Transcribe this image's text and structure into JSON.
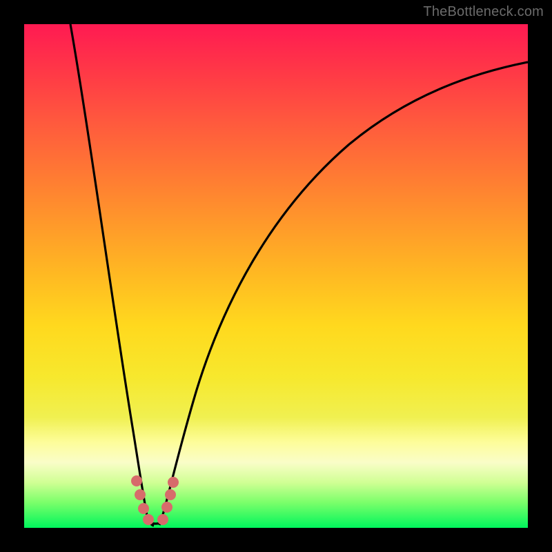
{
  "watermark": "TheBottleneck.com",
  "colors": {
    "frame": "#000000",
    "gradient_top": "#ff1a52",
    "gradient_bottom": "#00f55c",
    "curve": "#000000",
    "marker": "#d76b6b"
  },
  "chart_data": {
    "type": "line",
    "title": "",
    "xlabel": "",
    "ylabel": "",
    "xlim": [
      0,
      100
    ],
    "ylim": [
      0,
      100
    ],
    "grid": false,
    "legend": false,
    "note": "Axes are unlabeled; values estimated from pixel positions on a 0–100 scale.",
    "series": [
      {
        "name": "left-branch",
        "x": [
          9,
          11,
          13,
          15,
          17,
          18.5,
          20,
          21,
          22,
          24
        ],
        "y": [
          100,
          82,
          65,
          48,
          32,
          22,
          14,
          9,
          5,
          1
        ]
      },
      {
        "name": "valley",
        "x": [
          24,
          25,
          26,
          27,
          28
        ],
        "y": [
          1,
          0.5,
          0.5,
          0.6,
          1
        ]
      },
      {
        "name": "right-branch",
        "x": [
          28,
          30,
          33,
          37,
          42,
          48,
          55,
          63,
          72,
          82,
          92,
          100
        ],
        "y": [
          1,
          8,
          20,
          34,
          47,
          58,
          67,
          75,
          81,
          86,
          89.5,
          92
        ]
      }
    ],
    "markers": [
      {
        "x": 21.5,
        "y": 8
      },
      {
        "x": 22.2,
        "y": 5
      },
      {
        "x": 23.0,
        "y": 3
      },
      {
        "x": 24.2,
        "y": 1.2
      },
      {
        "x": 27.8,
        "y": 1.2
      },
      {
        "x": 28.6,
        "y": 3.5
      },
      {
        "x": 29.2,
        "y": 6
      },
      {
        "x": 29.8,
        "y": 8.5
      }
    ]
  }
}
